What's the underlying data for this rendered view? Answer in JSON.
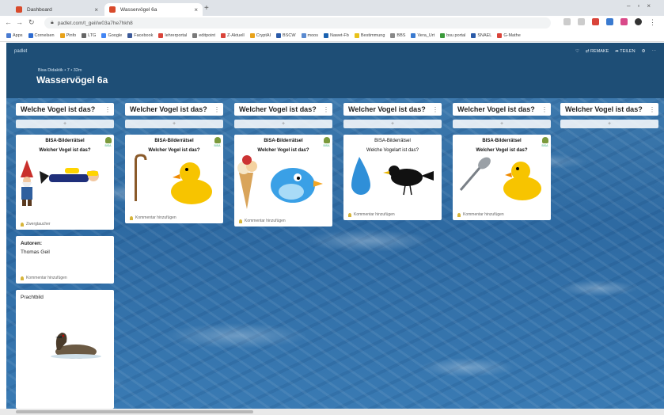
{
  "browser": {
    "tabs": [
      {
        "label": "Dashboard",
        "color": "#d84a2b"
      },
      {
        "label": "Wasservögel 6a",
        "color": "#d84a2b"
      }
    ],
    "url": "padlet.com/t_geil/w03a7he7hkh8",
    "bookmarks": [
      {
        "label": "Apps",
        "color": "#4a7bd1"
      },
      {
        "label": "Cornelsen",
        "color": "#2d6bd0"
      },
      {
        "label": "Pinfo",
        "color": "#e8a21a"
      },
      {
        "label": "LTG",
        "color": "#666666"
      },
      {
        "label": "Google",
        "color": "#4285f4"
      },
      {
        "label": "Facebook",
        "color": "#3b5998"
      },
      {
        "label": "lehrerportal",
        "color": "#d9443a"
      },
      {
        "label": "editpoint",
        "color": "#7a7a7a"
      },
      {
        "label": "Z-Aktuell",
        "color": "#d9443a"
      },
      {
        "label": "CryptAI",
        "color": "#e8a21a"
      },
      {
        "label": "BSCW",
        "color": "#2a5aa8"
      },
      {
        "label": "moos",
        "color": "#5a8ad0"
      },
      {
        "label": "Nawet-Fb",
        "color": "#1a62b0"
      },
      {
        "label": "Bestimmung",
        "color": "#e8c21a"
      },
      {
        "label": "BBS",
        "color": "#888888"
      },
      {
        "label": "Vera_Urt",
        "color": "#3a7ad0"
      },
      {
        "label": "bsu portal",
        "color": "#3a9a3a"
      },
      {
        "label": "SNAEL",
        "color": "#2a5aa8"
      },
      {
        "label": "G-Mathe",
        "color": "#d9443a"
      }
    ]
  },
  "padlet": {
    "brand": "padlet",
    "breadcrumb": "Bisa Didaktik  •  7  •  32m",
    "title": "Wasservögel 6a",
    "actions": [
      "♡",
      "⇄ REMAKE",
      "➦ TEILEN",
      "⚙",
      "⋯"
    ],
    "add_label": "+",
    "columns": [
      {
        "header": "Welche Vogel ist das?",
        "card": {
          "line1": "BISA-Bilderrätsel",
          "line2": "Welcher Vogel ist das?",
          "footer": "Zwergtaucher"
        },
        "extra_card_label": "Autoren:",
        "extra_card_value": "Thomas Geil",
        "extra_card_footer": "Kommentar hinzufügen",
        "image_card_label": "Prachtbild"
      },
      {
        "header": "Welcher Vogel ist das?",
        "card": {
          "line1": "BISA-Bilderrätsel",
          "line2": "Welcher Vogel ist das?",
          "footer": "Kommentar hinzufügen"
        }
      },
      {
        "header": "Welcher Vogel ist das?",
        "card": {
          "line1": "BISA-Bilderrätsel",
          "line2": "Welcher Vogel ist das?",
          "footer": "Kommentar hinzufügen"
        }
      },
      {
        "header": "Welcher Vogel ist das?",
        "card": {
          "line1": "BISA-Bilderrätsel",
          "line2": "Welche Vogelart ist das?",
          "footer": "Kommentar hinzufügen"
        }
      },
      {
        "header": "Welcher Vogel ist das?",
        "card": {
          "line1": "BISA-Bilderrätsel",
          "line2": "Welcher Vogel ist das?",
          "footer": "Kommentar hinzufügen"
        }
      },
      {
        "header": "Welcher Vogel ist das?"
      }
    ],
    "bisa_logo_text": "BISA"
  }
}
